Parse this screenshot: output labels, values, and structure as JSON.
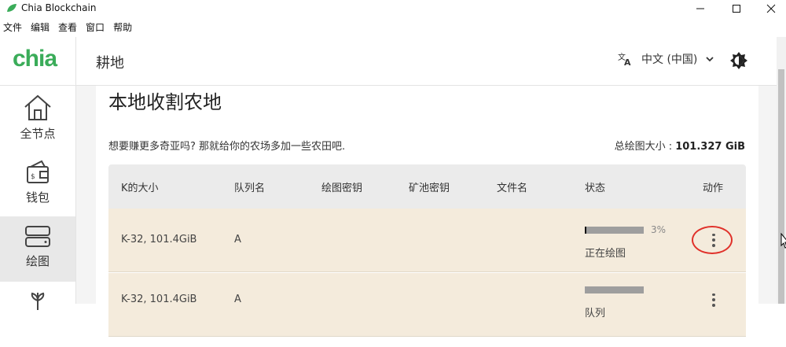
{
  "window": {
    "title": "Chia Blockchain",
    "controls": [
      "minimize",
      "maximize",
      "close"
    ]
  },
  "menubar": [
    "文件",
    "编辑",
    "查看",
    "窗口",
    "帮助"
  ],
  "header": {
    "logo": "chia",
    "title": "耕地",
    "language": "中文 (中国)"
  },
  "sidebar": {
    "items": [
      {
        "label": "全节点",
        "icon": "home-icon",
        "active": false
      },
      {
        "label": "钱包",
        "icon": "wallet-icon",
        "active": false
      },
      {
        "label": "绘图",
        "icon": "plot-drive-icon",
        "active": true
      },
      {
        "label": "",
        "icon": "farm-sprout-icon",
        "active": false
      }
    ]
  },
  "main": {
    "section_title": "本地收割农地",
    "promo_text": "想要赚更多奇亚吗? 那就给你的农场多加一些农田吧.",
    "total_label": "总绘图大小 :",
    "total_value": "101.327 GiB",
    "columns": [
      "K的大小",
      "队列名",
      "绘图密钥",
      "矿池密钥",
      "文件名",
      "状态",
      "动作"
    ],
    "rows": [
      {
        "size": "K-32, 101.4GiB",
        "queue": "A",
        "plot_key": "",
        "pool_key": "",
        "filename": "",
        "progress": 0.03,
        "progress_label": "3%",
        "status": "正在绘图"
      },
      {
        "size": "K-32, 101.4GiB",
        "queue": "A",
        "plot_key": "",
        "pool_key": "",
        "filename": "",
        "progress": 0.0,
        "progress_label": "",
        "status": "队列"
      }
    ]
  },
  "colors": {
    "brand": "#3aac59",
    "row_bg": "#f4ebdc",
    "highlight": "#e0312a"
  }
}
